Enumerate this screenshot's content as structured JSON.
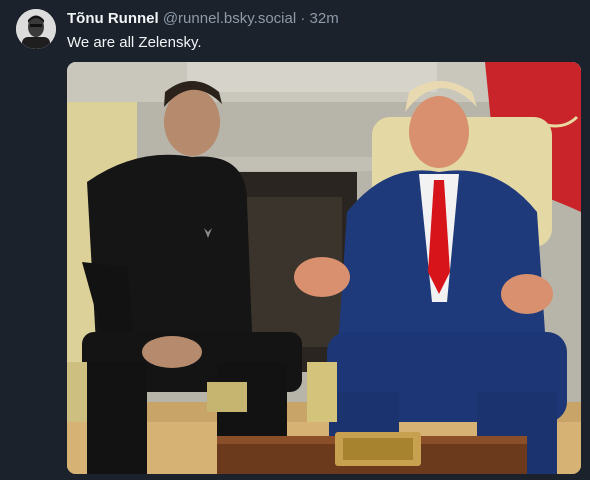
{
  "post": {
    "author_name": "Tõnu Runnel",
    "author_handle": "@runnel.bsky.social",
    "separator": "·",
    "timestamp": "32m",
    "text": "We are all Zelensky."
  },
  "icons": {
    "avatar": "avatar-portrait",
    "embedded_image": "photo"
  },
  "colors": {
    "background": "#1b222c",
    "name_text": "#f1f3f5",
    "meta_text": "#8e9aa8"
  }
}
